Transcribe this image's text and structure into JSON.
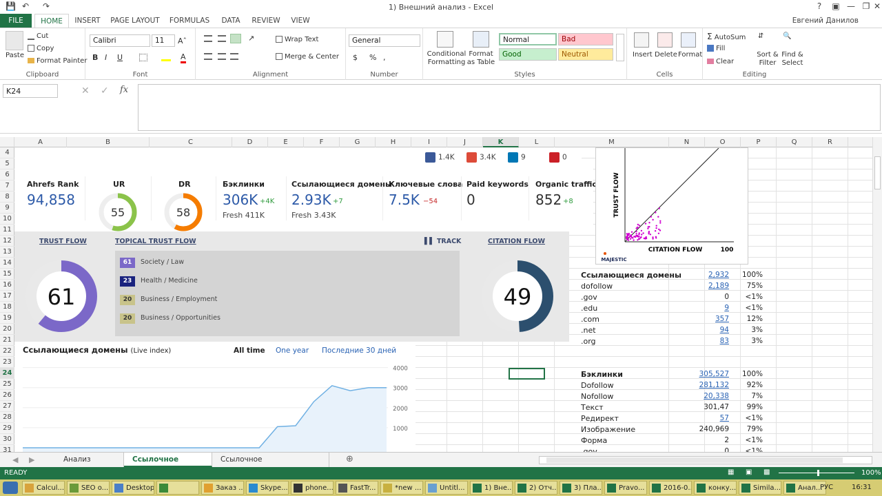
{
  "window": {
    "title": "1) Внешний анализ - Excel",
    "user": "Евгений Данилов"
  },
  "ribbon_tabs": [
    "FILE",
    "HOME",
    "INSERT",
    "PAGE LAYOUT",
    "FORMULAS",
    "DATA",
    "REVIEW",
    "VIEW"
  ],
  "clipboard": {
    "paste": "Paste",
    "cut": "Cut",
    "copy": "Copy",
    "format_painter": "Format Painter",
    "label": "Clipboard"
  },
  "font": {
    "name": "Calibri",
    "size": "11",
    "label": "Font",
    "bold": "B",
    "italic": "I",
    "underline": "U"
  },
  "alignment": {
    "wrap": "Wrap Text",
    "merge": "Merge & Center",
    "label": "Alignment"
  },
  "number": {
    "format": "General",
    "label": "Number",
    "currency": "$",
    "percent": "%",
    "comma": ","
  },
  "styles": {
    "cond": "Conditional Formatting",
    "table": "Format as Table",
    "normal": "Normal",
    "bad": "Bad",
    "good": "Good",
    "neutral": "Neutral",
    "label": "Styles"
  },
  "cells": {
    "insert": "Insert",
    "delete": "Delete",
    "format": "Format",
    "label": "Cells"
  },
  "editing": {
    "autosum": "AutoSum",
    "fill": "Fill",
    "clear": "Clear",
    "sort": "Sort & Filter",
    "find": "Find & Select",
    "label": "Editing"
  },
  "formula_bar": {
    "name_box": "K24",
    "fx": "fx",
    "value": ""
  },
  "columns": [
    "A",
    "B",
    "C",
    "D",
    "E",
    "F",
    "G",
    "H",
    "I",
    "J",
    "K",
    "L",
    "M",
    "N",
    "O",
    "P",
    "Q",
    "R"
  ],
  "rows": [
    "4",
    "5",
    "6",
    "7",
    "8",
    "9",
    "10",
    "11",
    "12",
    "13",
    "14",
    "15",
    "16",
    "17",
    "18",
    "19",
    "20",
    "21",
    "22",
    "23",
    "24",
    "25",
    "26",
    "27",
    "28",
    "29",
    "30",
    "31"
  ],
  "active_row": "24",
  "active_col": "K",
  "social": [
    {
      "icon": "facebook-icon",
      "value": "1.4K",
      "color": "#3b5998"
    },
    {
      "icon": "google-plus-icon",
      "value": "3.4K",
      "color": "#dd4b39"
    },
    {
      "icon": "linkedin-icon",
      "value": "9",
      "color": "#0077b5"
    },
    {
      "icon": "pinterest-icon",
      "value": "0",
      "color": "#cb2027"
    }
  ],
  "ahrefs": {
    "rank_label": "Ahrefs Rank",
    "rank": "94,858",
    "ur_label": "UR",
    "ur": "55",
    "ur_fill": 0.55,
    "dr_label": "DR",
    "dr": "58",
    "dr_fill": 0.58,
    "backlinks_label": "Бэклинки",
    "backlinks": "306K",
    "backlinks_delta": "+4K",
    "backlinks_fresh": "Fresh 411K",
    "refdomains_label": "Ссылающиеся домены",
    "refdomains": "2.93K",
    "refdomains_delta": "+7",
    "refdomains_fresh": "Fresh 3.43K",
    "keywords_label": "Ключевые слова",
    "keywords": "7.5K",
    "keywords_delta": "−54",
    "paid_label": "Paid keywords",
    "paid": "0",
    "organic_label": "Organic traffic",
    "organic": "852",
    "organic_delta": "+8"
  },
  "majestic": {
    "trust_flow_label": "TRUST FLOW",
    "trust_flow": "61",
    "trust_fill": 0.61,
    "topical_label": "TOPICAL TRUST FLOW",
    "track_label": "TRACK",
    "citation_flow_label": "CITATION FLOW",
    "citation_flow": "49",
    "citation_fill": 0.49,
    "topics": [
      {
        "value": "61",
        "name": "Society / Law",
        "color": "#7b68c8"
      },
      {
        "value": "23",
        "name": "Health / Medicine",
        "color": "#1a237e"
      },
      {
        "value": "20",
        "name": "Business / Employment",
        "color": "#c8c38a"
      },
      {
        "value": "20",
        "name": "Business / Opportunities",
        "color": "#c8c38a"
      }
    ],
    "scatter_y_label": "TRUST FLOW",
    "scatter_x_label": "CITATION FLOW",
    "scatter_max": "100",
    "logo": "MAJESTIC"
  },
  "refdomains_chart": {
    "title": "Ссылающиеся домены",
    "subtitle": "(Live index)",
    "filters": [
      "All time",
      "One year",
      "Последние 30 дней"
    ],
    "y_ticks": [
      "4000",
      "3000",
      "2000",
      "1000"
    ]
  },
  "chart_data": {
    "type": "area",
    "title": "Ссылающиеся домены",
    "x": [
      0,
      1,
      2,
      3,
      4,
      5,
      6,
      7,
      8,
      9,
      10,
      11,
      12,
      13,
      14,
      15,
      16,
      17,
      18,
      19,
      20
    ],
    "values": [
      0,
      0,
      0,
      0,
      0,
      0,
      0,
      0,
      0,
      0,
      0,
      0,
      0,
      0,
      1050,
      1100,
      2300,
      3100,
      2850,
      3000,
      3000
    ],
    "ylim": [
      0,
      4000
    ]
  },
  "refdomains_table": {
    "header": {
      "label": "Ссылающиеся домены",
      "count": "2,932",
      "pct": "100%"
    },
    "rows": [
      {
        "label": "dofollow",
        "count": "2,189",
        "pct": "75%",
        "link": true
      },
      {
        "label": ".gov",
        "count": "0",
        "pct": "<1%",
        "link": false
      },
      {
        "label": ".edu",
        "count": "9",
        "pct": "<1%",
        "link": true
      },
      {
        "label": ".com",
        "count": "357",
        "pct": "12%",
        "link": true
      },
      {
        "label": ".net",
        "count": "94",
        "pct": "3%",
        "link": true
      },
      {
        "label": ".org",
        "count": "83",
        "pct": "3%",
        "link": true
      }
    ]
  },
  "backlinks_table": {
    "header": {
      "label": "Бэклинки",
      "count": "305,527",
      "pct": "100%"
    },
    "rows": [
      {
        "label": "Dofollow",
        "count": "281,132",
        "pct": "92%",
        "link": true
      },
      {
        "label": "Nofollow",
        "count": "20,338",
        "pct": "7%",
        "link": true
      },
      {
        "label": "Текст",
        "count": "301,47",
        "pct": "99%",
        "link": false
      },
      {
        "label": "Редирект",
        "count": "57",
        "pct": "<1%",
        "link": true
      },
      {
        "label": "Изображение",
        "count": "240,969",
        "pct": "79%",
        "link": false
      },
      {
        "label": "Форма",
        "count": "2",
        "pct": "<1%",
        "link": false
      },
      {
        "label": ".gov",
        "count": "0",
        "pct": "<1%",
        "link": false
      }
    ]
  },
  "sheets": [
    "Анализ трафика",
    "Ссылочное pravoved",
    "Ссылочное новыеформы.рф"
  ],
  "active_sheet": 1,
  "status": {
    "ready": "READY",
    "zoom": "100%"
  },
  "taskbar": [
    "Calcul...",
    "SEO o...",
    "Desktop",
    "",
    "Заказ ...",
    "Skype...",
    "phone...",
    "FastTr...",
    "*new ...",
    "Untitl...",
    "1) Вне...",
    "2) Отч...",
    "3) Пла...",
    "Pravo...",
    "2016-0...",
    "конку...",
    "Simila...",
    "Анал..."
  ],
  "tray": {
    "lang": "РУС",
    "time": "16:31"
  }
}
